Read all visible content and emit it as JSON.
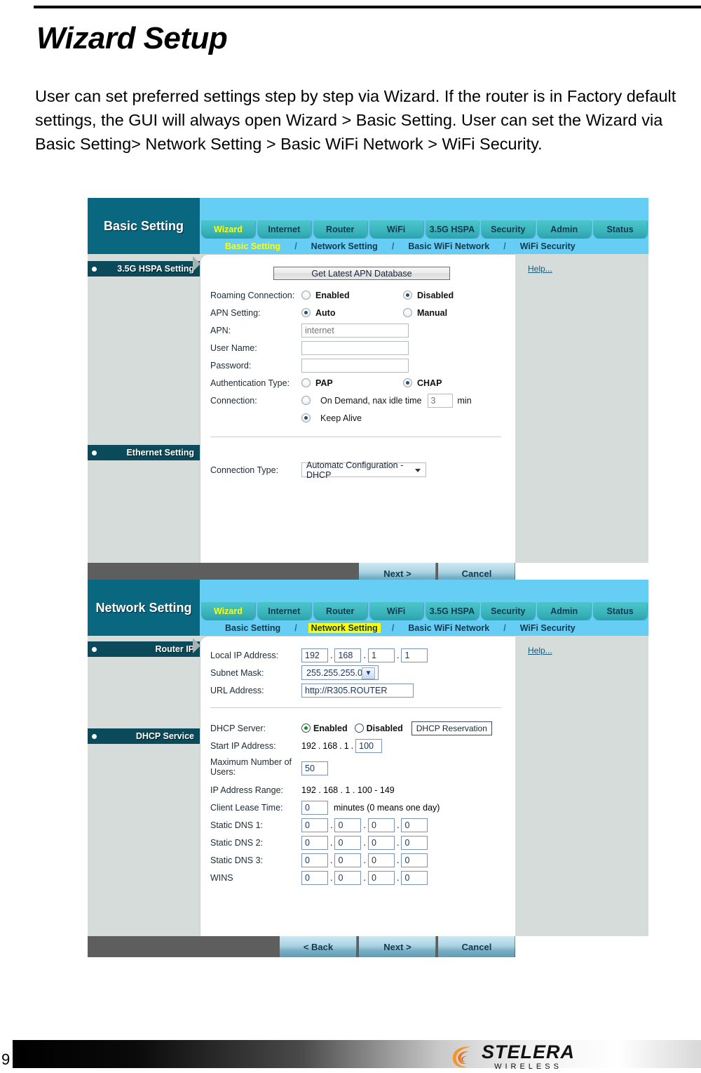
{
  "document": {
    "title": "Wizard Setup",
    "body_text": "User can set preferred settings step by step via Wizard. If the router is in Factory default settings, the GUI will always open Wizard > Basic Setting. User can set the Wizard via Basic Setting> Network Setting > Basic WiFi Network > WiFi Security.",
    "page_number": "9"
  },
  "footer": {
    "logo_main": "STELERA",
    "logo_sub": "WIRELESS"
  },
  "colors": {
    "brand_dark_teal": "#0a6780",
    "sidebar_item": "#0a4a5a",
    "nav_blue": "#66cdf5",
    "tab_teal": "#3cb6bd",
    "active_yellow": "#ffff00",
    "panel_grey": "#d6dcda",
    "button_bar_grey": "#5e5e5e"
  },
  "panel1": {
    "brand": "Basic Setting",
    "tabs": [
      {
        "label": "Wizard",
        "active": true
      },
      {
        "label": "Internet",
        "active": false
      },
      {
        "label": "Router",
        "active": false
      },
      {
        "label": "WiFi",
        "active": false
      },
      {
        "label": "3.5G HSPA",
        "active": false
      },
      {
        "label": "Security",
        "active": false
      },
      {
        "label": "Admin",
        "active": false
      },
      {
        "label": "Status",
        "active": false
      }
    ],
    "crumbs": [
      {
        "label": "Basic Setting",
        "active": true
      },
      {
        "label": "Network Setting",
        "active": false
      },
      {
        "label": "Basic WiFi Network",
        "active": false
      },
      {
        "label": "WiFi Security",
        "active": false
      }
    ],
    "separator": "/",
    "sidebar": [
      {
        "label": "3.5G HSPA Setting"
      },
      {
        "label": "Ethernet Setting"
      }
    ],
    "help_label": "Help...",
    "apn_button": "Get Latest APN Database",
    "fields": {
      "roaming_label": "Roaming Connection:",
      "roaming_enabled": "Enabled",
      "roaming_disabled": "Disabled",
      "roaming_value": "Disabled",
      "apn_setting_label": "APN Setting:",
      "apn_auto": "Auto",
      "apn_manual": "Manual",
      "apn_setting_value": "Auto",
      "apn_label": "APN:",
      "apn_placeholder": "internet",
      "apn_value": "",
      "username_label": "User Name:",
      "username_value": "",
      "password_label": "Password:",
      "password_value": "",
      "auth_label": "Authentication Type:",
      "auth_pap": "PAP",
      "auth_chap": "CHAP",
      "auth_value": "CHAP",
      "connection_label": "Connection:",
      "on_demand": "On Demand, nax idle time",
      "idle_time_value": "3",
      "idle_unit": "min",
      "keep_alive": "Keep Alive",
      "connection_value": "Keep Alive",
      "conn_type_label": "Connection Type:",
      "conn_type_value": "Automatc Configuration - DHCP"
    },
    "buttons": [
      {
        "label": "Next >"
      },
      {
        "label": "Cancel"
      }
    ]
  },
  "panel2": {
    "brand": "Network Setting",
    "tabs": [
      {
        "label": "Wizard",
        "active": true
      },
      {
        "label": "Internet",
        "active": false
      },
      {
        "label": "Router",
        "active": false
      },
      {
        "label": "WiFi",
        "active": false
      },
      {
        "label": "3.5G HSPA",
        "active": false
      },
      {
        "label": "Security",
        "active": false
      },
      {
        "label": "Admin",
        "active": false
      },
      {
        "label": "Status",
        "active": false
      }
    ],
    "crumbs": [
      {
        "label": "Basic Setting",
        "active": false
      },
      {
        "label": "Network Setting",
        "active": true
      },
      {
        "label": "Basic WiFi Network",
        "active": false
      },
      {
        "label": "WiFi Security",
        "active": false
      }
    ],
    "separator": "/",
    "sidebar": [
      {
        "label": "Router IP"
      },
      {
        "label": "DHCP Service"
      }
    ],
    "help_label": "Help...",
    "fields": {
      "local_ip_label": "Local IP Address:",
      "local_ip": [
        "192",
        "168",
        "1",
        "1"
      ],
      "subnet_label": "Subnet Mask:",
      "subnet_value": "255.255.255.0",
      "url_label": "URL Address:",
      "url_value": "http://R305.ROUTER",
      "dhcp_server_label": "DHCP Server:",
      "dhcp_enabled": "Enabled",
      "dhcp_disabled": "Disabled",
      "dhcp_server_value": "Enabled",
      "dhcp_reservation": "DHCP Reservation",
      "start_ip_label": "Start IP Address:",
      "start_ip_prefix": [
        "192",
        "168",
        "1"
      ],
      "start_ip_last": "100",
      "max_users_label": "Maximum Number of Users:",
      "max_users_value": "50",
      "ip_range_label": "IP Address Range:",
      "ip_range_value": "192 . 168 . 1 . 100 - 149",
      "lease_label": "Client Lease Time:",
      "lease_value": "0",
      "lease_unit": "minutes (0 means one day)",
      "dns1_label": "Static DNS 1:",
      "dns1": [
        "0",
        "0",
        "0",
        "0"
      ],
      "dns2_label": "Static DNS 2:",
      "dns2": [
        "0",
        "0",
        "0",
        "0"
      ],
      "dns3_label": "Static DNS 3:",
      "dns3": [
        "0",
        "0",
        "0",
        "0"
      ],
      "wins_label": "WINS",
      "wins": [
        "0",
        "0",
        "0",
        "0"
      ]
    },
    "buttons": [
      {
        "label": "< Back"
      },
      {
        "label": "Next >"
      },
      {
        "label": "Cancel"
      }
    ]
  }
}
